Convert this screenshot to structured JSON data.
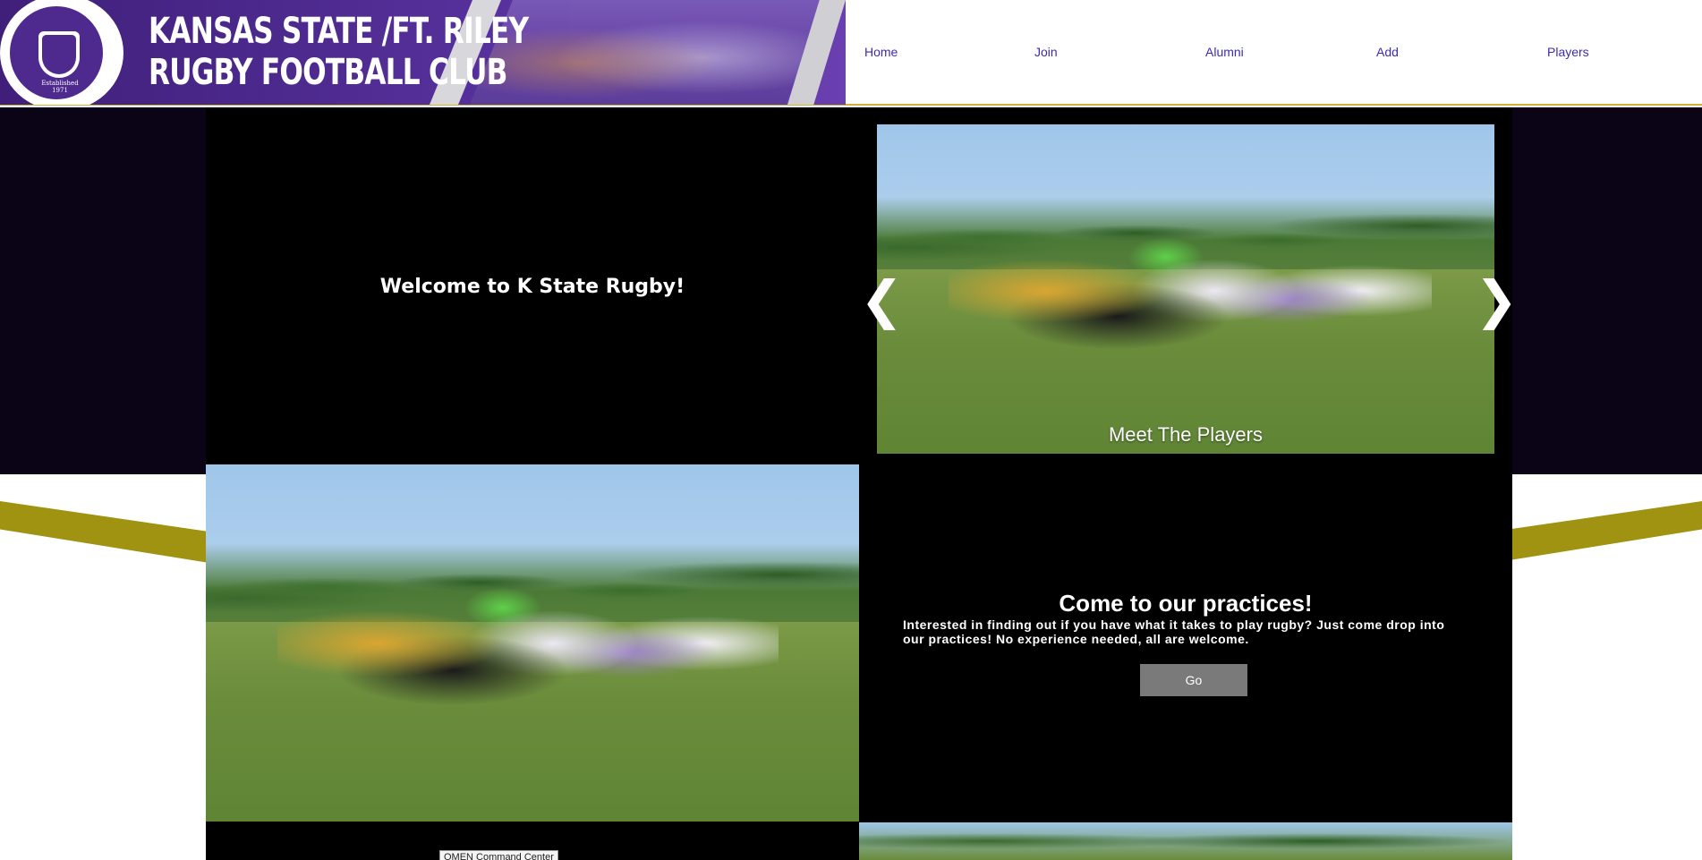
{
  "header": {
    "title_line1": "KANSAS STATE /FT. RILEY",
    "title_line2": "RUGBY FOOTBALL CLUB",
    "logo_text": "Established 1971"
  },
  "nav": {
    "items": [
      {
        "label": "Home"
      },
      {
        "label": "Join"
      },
      {
        "label": "Alumni"
      },
      {
        "label": "Add"
      },
      {
        "label": "Players"
      }
    ]
  },
  "hero": {
    "welcome": "Welcome to K State Rugby!"
  },
  "slider": {
    "caption": "Meet The Players",
    "prev_icon": "chevron-left-icon",
    "next_icon": "chevron-right-icon",
    "prev_glyph": "❮",
    "next_glyph": "❯"
  },
  "practice": {
    "title": "Come to our practices!",
    "body": "Interested in finding out if you have what it takes to play rugby? Just come drop into our practices! No experience needed, all are welcome.",
    "button_label": "Go"
  },
  "tooltip": {
    "text": "OMEN Command Center"
  },
  "colors": {
    "purple": "#4e2a8e",
    "gold": "#a09311",
    "nav_link": "#3c2bb0",
    "dark_bg": "#0b0416"
  }
}
